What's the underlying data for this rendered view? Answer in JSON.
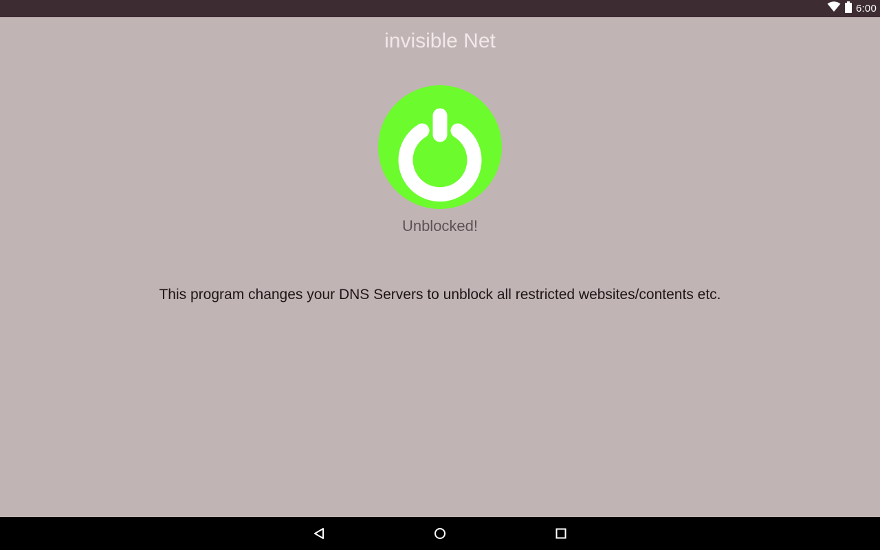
{
  "status_bar": {
    "time": "6:00",
    "icons": [
      "wifi-icon",
      "battery-icon"
    ]
  },
  "app": {
    "title": "invisible Net"
  },
  "main": {
    "power_button_icon": "power-icon",
    "power_color": "#6cfb2d",
    "status_text": "Unblocked!",
    "description": "This program changes your DNS Servers to unblock all restricted websites/contents etc."
  },
  "nav_bar": {
    "items": [
      "back-icon",
      "home-icon",
      "recents-icon"
    ]
  },
  "colors": {
    "background": "#c1b4b4",
    "status_bar": "#3e2c33",
    "nav_bar": "#000000"
  }
}
